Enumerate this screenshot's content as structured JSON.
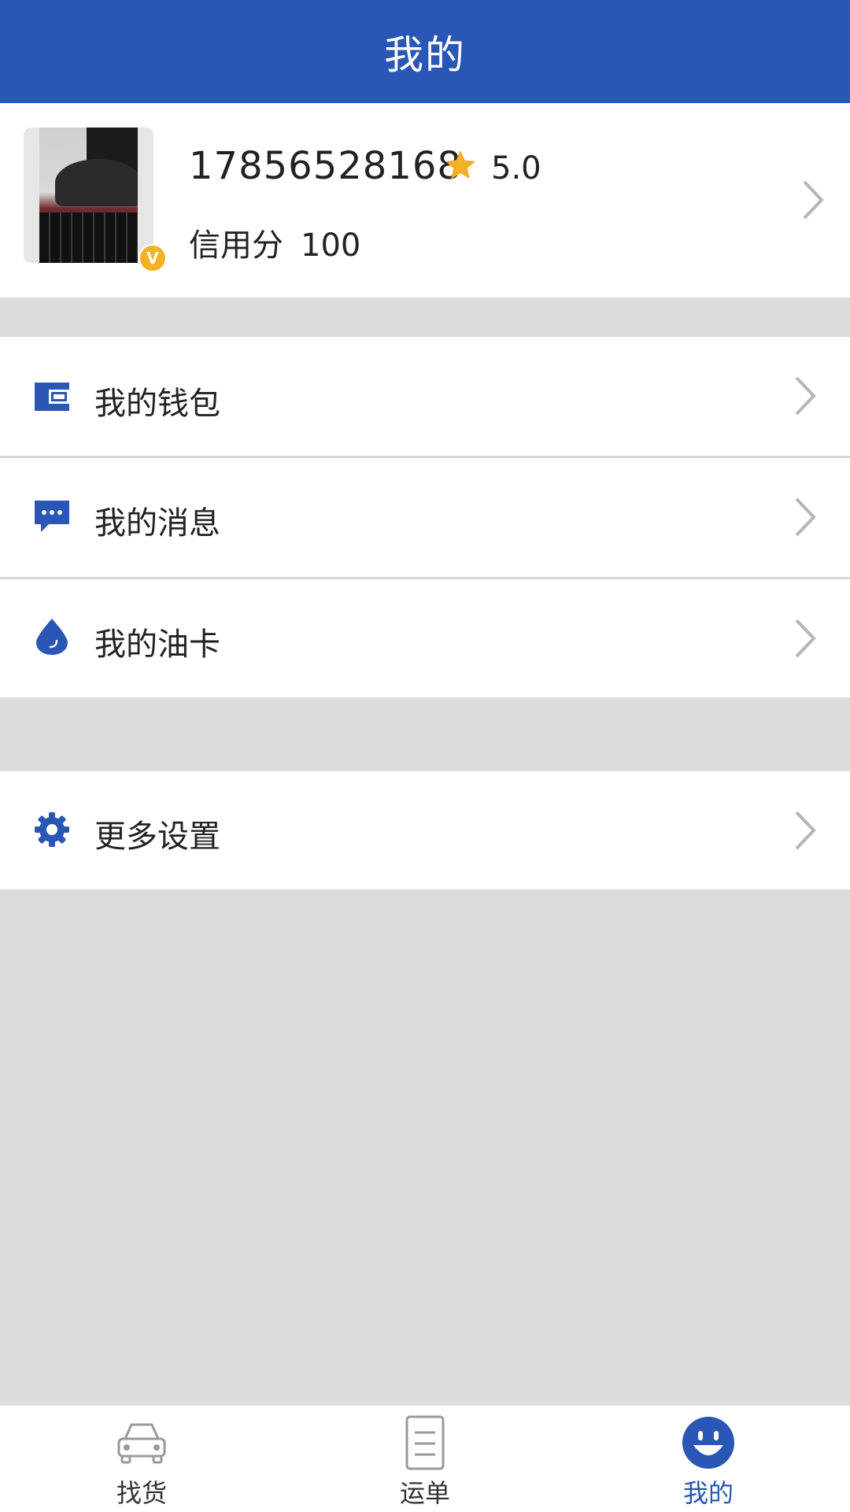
{
  "header": {
    "title": "我的"
  },
  "profile": {
    "phone": "17856528168",
    "rating": "5.0",
    "credit_label": "信用分",
    "credit_value": "100",
    "verified_badge": "V"
  },
  "menu": [
    {
      "label": "我的钱包",
      "icon": "wallet-icon"
    },
    {
      "label": "我的消息",
      "icon": "message-icon"
    },
    {
      "label": "我的油卡",
      "icon": "oil-drop-icon"
    }
  ],
  "settings": {
    "label": "更多设置",
    "icon": "gear-icon"
  },
  "bottom_nav": {
    "tabs": [
      {
        "label": "找货",
        "icon": "truck-icon",
        "active": false
      },
      {
        "label": "运单",
        "icon": "document-icon",
        "active": false
      },
      {
        "label": "我的",
        "icon": "smiley-icon",
        "active": true
      }
    ]
  },
  "colors": {
    "primary": "#2a56b5",
    "background": "#dcdcdc",
    "star": "#f4b126",
    "chevron": "#b5b5b5"
  }
}
